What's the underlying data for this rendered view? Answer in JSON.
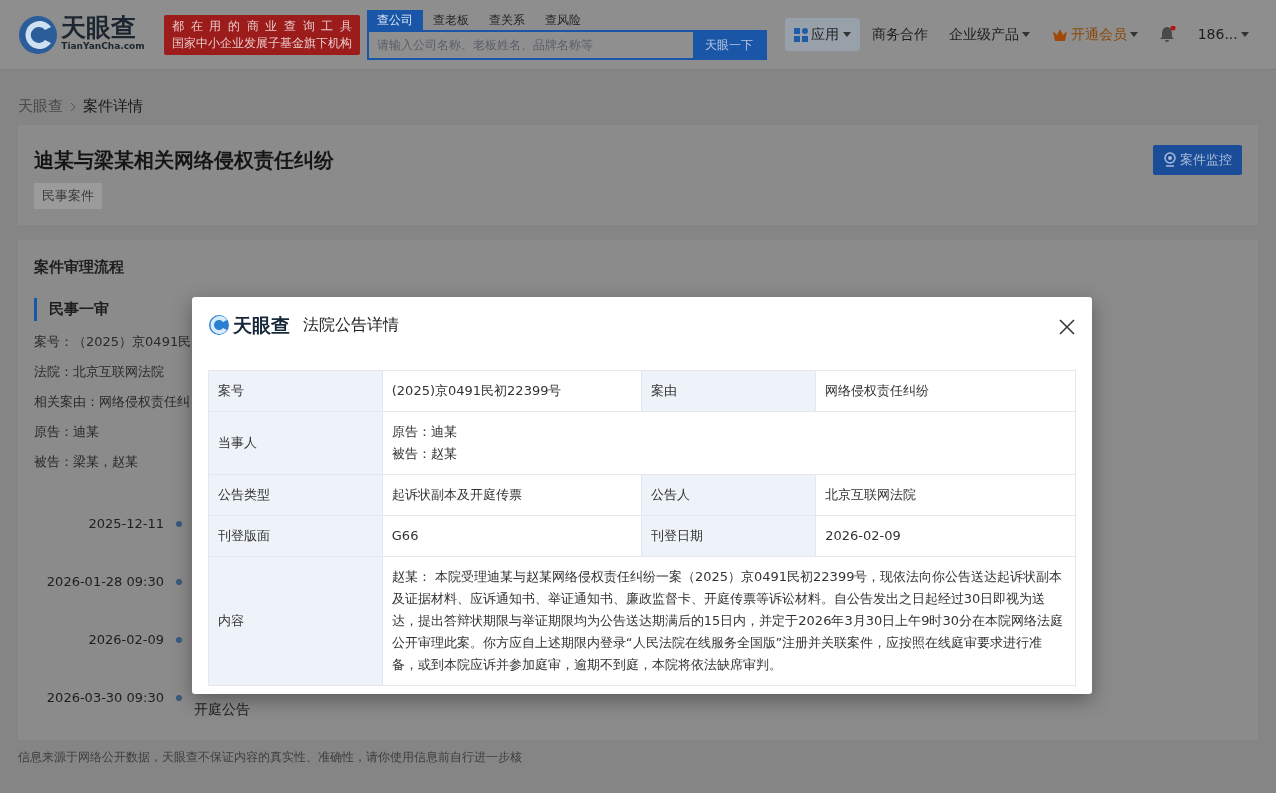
{
  "header": {
    "logo": {
      "name": "天眼查",
      "domain": "TianYanCha.com"
    },
    "slogan_lines": [
      "都在用的商业查询工具",
      "国家中小企业发展子基金旗下机构"
    ],
    "search": {
      "tabs": [
        {
          "label": "查公司",
          "selected": true
        },
        {
          "label": "查老板",
          "selected": false
        },
        {
          "label": "查关系",
          "selected": false
        },
        {
          "label": "查风险",
          "selected": false
        }
      ],
      "placeholder": "请输入公司名称、老板姓名、品牌名称等",
      "button": "天眼一下"
    },
    "nav": [
      {
        "kind": "apps",
        "label": "应用",
        "caret": true,
        "selected": true
      },
      {
        "kind": "text",
        "label": "商务合作",
        "caret": false,
        "selected": false
      },
      {
        "kind": "text",
        "label": "企业级产品",
        "caret": true,
        "selected": false
      },
      {
        "kind": "vip",
        "label": "开通会员",
        "caret": true,
        "selected": false
      },
      {
        "kind": "bell",
        "unread": true,
        "selected": false
      },
      {
        "kind": "text",
        "label": "186...",
        "caret": true,
        "selected": false
      }
    ]
  },
  "breadcrumb": [
    "天眼查",
    "案件详情"
  ],
  "case": {
    "title": "迪某与梁某相关网络侵权责任纠纷",
    "tag": "民事案件",
    "monitor_button": "案件监控"
  },
  "process": {
    "heading": "案件审理流程",
    "stage": "民事一审",
    "fields": [
      {
        "label": "案号：",
        "value": "（2025）京0491民"
      },
      {
        "label": "法院：",
        "value": "北京互联网法院"
      },
      {
        "label": "相关案由：",
        "value": "网络侵权责任纠"
      },
      {
        "label": "原告：",
        "value": "迪某"
      },
      {
        "label": "被告：",
        "value": "梁某，赵某"
      }
    ],
    "timeline": [
      {
        "date": "2025-12-11"
      },
      {
        "date": "2026-01-28 09:30"
      },
      {
        "date": "2026-02-09"
      },
      {
        "date": "2026-03-30 09:30",
        "label": "开庭公告"
      }
    ]
  },
  "footer": "信息来源于网络公开数据，天眼查不保证内容的真实性、准确性，请你使用信息前自行进一步核",
  "modal": {
    "logo": "天眼查",
    "title": "法院公告详情",
    "rows": [
      [
        {
          "label": "案号",
          "value": "(2025)京0491民初22399号"
        },
        {
          "label": "案由",
          "value": "网络侵权责任纠纷"
        }
      ],
      [
        {
          "label": "当事人",
          "lines": [
            "原告：迪某",
            "被告：赵某"
          ]
        }
      ],
      [
        {
          "label": "公告类型",
          "value": "起诉状副本及开庭传票"
        },
        {
          "label": "公告人",
          "value": "北京互联网法院"
        }
      ],
      [
        {
          "label": "刊登版面",
          "value": "G66"
        },
        {
          "label": "刊登日期",
          "value": "2026-02-09"
        }
      ],
      [
        {
          "label": "内容",
          "value": "赵某： 本院受理迪某与赵某网络侵权责任纠纷一案（2025）京0491民初22399号，现依法向你公告送达起诉状副本及证据材料、应诉通知书、举证通知书、廉政监督卡、开庭传票等诉讼材料。自公告发出之日起经过30日即视为送达，提出答辩状期限与举证期限均为公告送达期满后的15日内，并定于2026年3月30日上午9时30分在本院网络法庭公开审理此案。你方应自上述期限内登录“人民法院在线服务全国版”注册并关联案件，应按照在线庭审要求进行准备，或到本院应诉并参加庭审，逾期不到庭，本院将依法缺席审判。"
        }
      ]
    ]
  }
}
